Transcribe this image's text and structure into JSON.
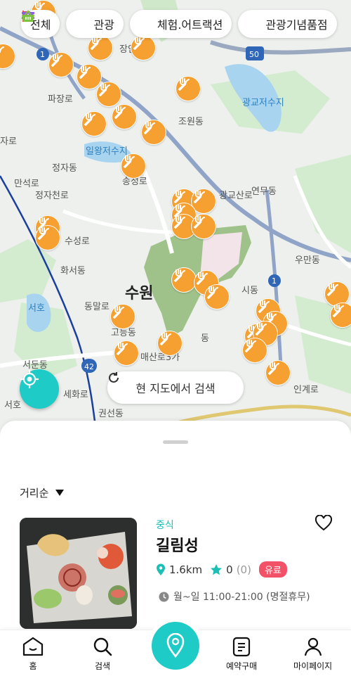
{
  "filters": [
    {
      "label": "전체",
      "icon": ""
    },
    {
      "label": "관광",
      "icon": "flag-icon"
    },
    {
      "label": "체험.어트랙션",
      "icon": "ticket-icon"
    },
    {
      "label": "관광기념품점",
      "icon": "shopping-basket-icon"
    }
  ],
  "map_labels": {
    "l1": "광교저수지",
    "l2": "일왕저수지",
    "l3": "수원",
    "l4": "서호",
    "l5": "조원동",
    "l6": "정자동",
    "l7": "파장로",
    "l8": "수성로",
    "l9": "화서동",
    "l10": "동말로",
    "l11": "고등동",
    "l12": "매산로3가",
    "l13": "서둔동",
    "l14": "권선동",
    "l15": "우만동",
    "l16": "인계로",
    "l17": "광교산로",
    "l18": "연무동",
    "l19": "정자천로",
    "l20": "만석로",
    "l21": "송정로",
    "l22": "장안",
    "l23": "자로",
    "l24": "시동",
    "l25": "동",
    "l26": "세화로",
    "l27": "서호"
  },
  "road_badges": {
    "r1": "1",
    "r2": "50",
    "r3": "1",
    "r4": "42"
  },
  "search_here": "현 지도에서 검색",
  "sort": {
    "label": "거리순"
  },
  "card": {
    "category": "중식",
    "name": "길림성",
    "distance": "1.6km",
    "rating": "0",
    "reviews": "(0)",
    "badge": "유료",
    "hours": "월~일 11:00-21:00 (명절휴무)"
  },
  "nav": {
    "home": "홈",
    "search": "검색",
    "booking": "예약구매",
    "mypage": "마이페이지"
  },
  "colors": {
    "accent": "#1ecbc6",
    "pin": "#f5a030",
    "paid": "#f25167"
  }
}
